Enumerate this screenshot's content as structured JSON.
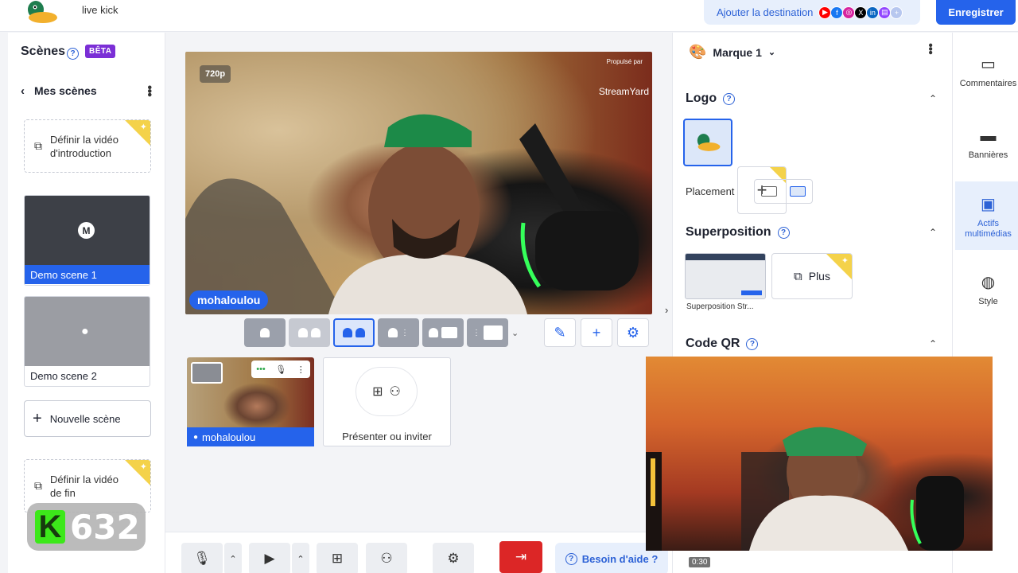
{
  "header": {
    "stream_title": "live kick",
    "add_destination": "Ajouter la destination",
    "record": "Enregistrer"
  },
  "scenes": {
    "title": "Scènes",
    "beta": "BÊTA",
    "my_scenes": "Mes scènes",
    "intro_video": "Définir la vidéo d'introduction",
    "items": [
      {
        "label": "Demo scene 1",
        "avatar": "M"
      },
      {
        "label": "Demo scene 2"
      }
    ],
    "new_scene": "Nouvelle scène",
    "end_video": "Définir la vidéo de fin"
  },
  "stage": {
    "resolution": "720p",
    "powered_by": "Propulsé par",
    "brand_watermark": "StreamYard",
    "participant": "mohaloulou"
  },
  "guests": {
    "camera_name": "mohaloulou",
    "present_invite": "Présenter ou inviter"
  },
  "bottom": {
    "help": "Besoin d'aide ?"
  },
  "brand_panel": {
    "brand_name": "Marque 1",
    "logo_title": "Logo",
    "placement": "Placement",
    "overlay_title": "Superposition",
    "overlay_label": "Superposition Str...",
    "plus": "Plus",
    "qr_title": "Code QR"
  },
  "rail": {
    "items": [
      "Commentaires",
      "Bannières",
      "Actifs multimédias",
      "Style"
    ]
  },
  "webcam": {
    "timer": "0:30"
  },
  "kick": {
    "letter": "K",
    "viewers": "632"
  },
  "colors": {
    "accent": "#2563eb",
    "beta": "#7b2fd6",
    "exit": "#dc2626",
    "kick": "#3ce81a"
  }
}
